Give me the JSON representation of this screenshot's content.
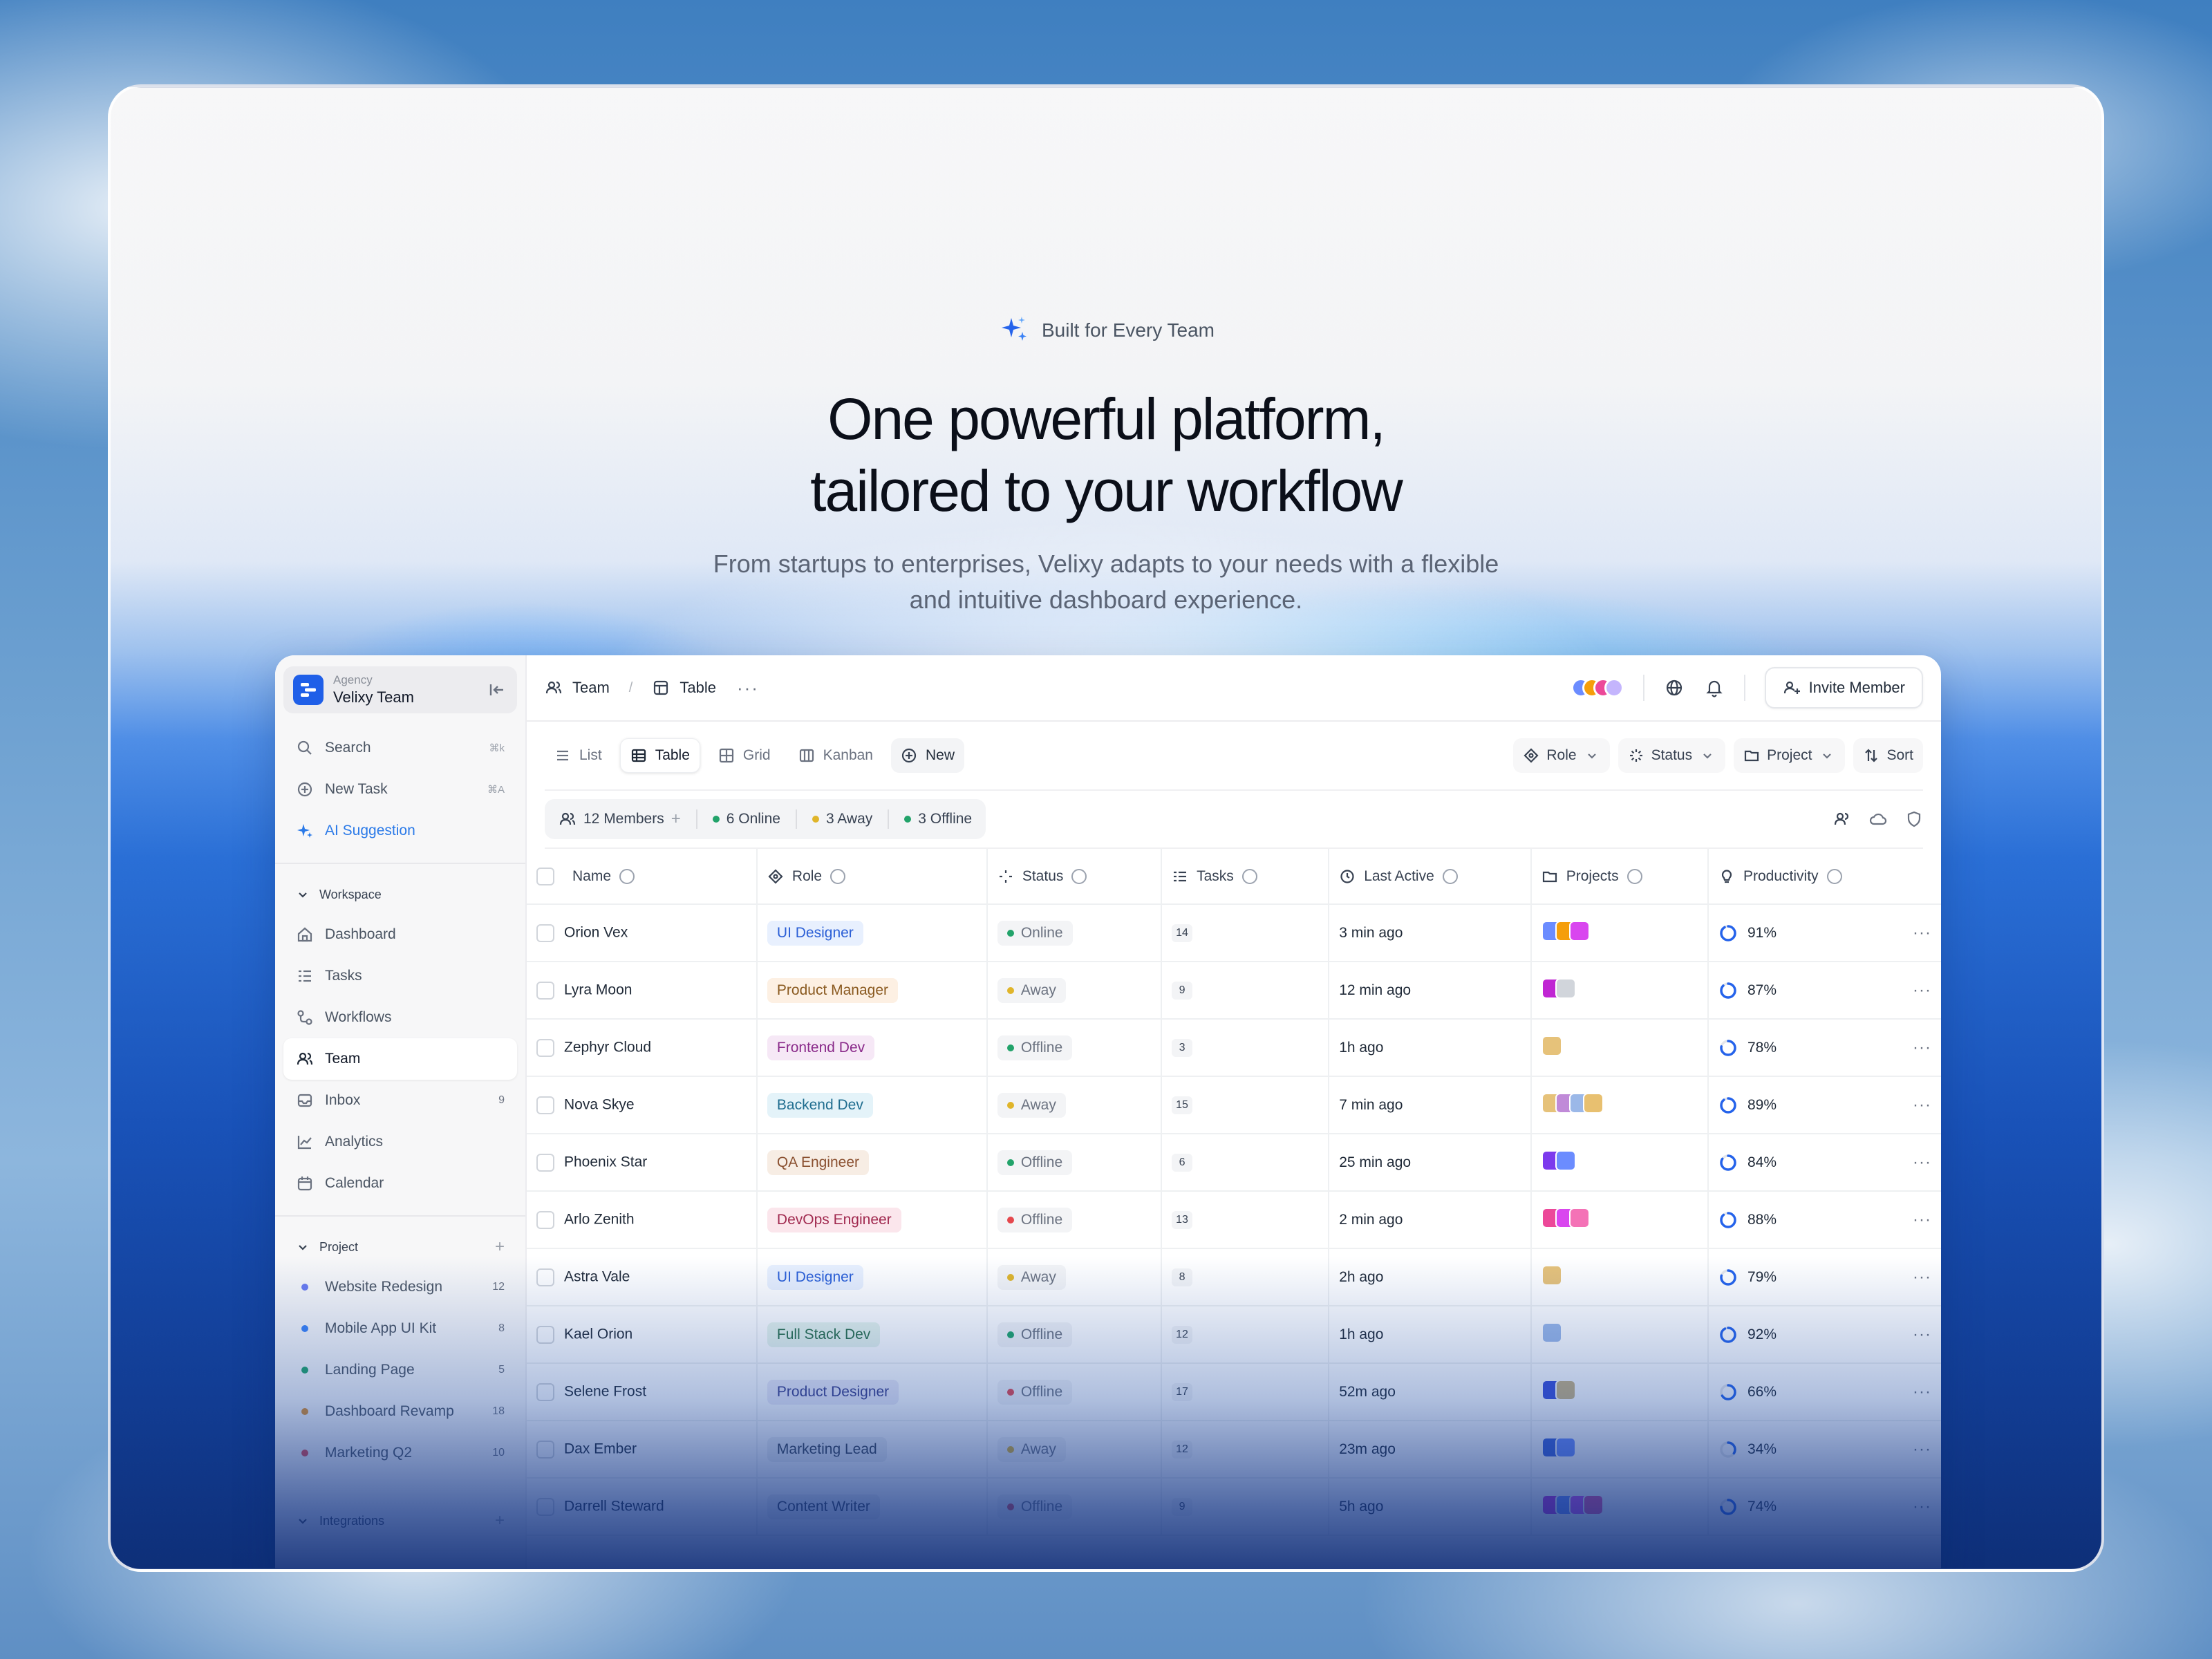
{
  "hero": {
    "badge": "Built for Every Team",
    "headline_1": "One powerful platform,",
    "headline_2": "tailored to your workflow",
    "sub_1": "From startups to enterprises, Velixy adapts to your needs with a flexible",
    "sub_2": "and intuitive dashboard experience."
  },
  "workspace": {
    "type": "Agency",
    "name": "Velixy Team"
  },
  "sidebar": {
    "quick": [
      {
        "label": "Search",
        "kbd": "⌘k",
        "icon": "search-icon"
      },
      {
        "label": "New Task",
        "kbd": "⌘A",
        "icon": "plus-circle-icon"
      },
      {
        "label": "AI Suggestion",
        "kbd": "",
        "icon": "sparkle-icon"
      }
    ],
    "workspace_title": "Workspace",
    "workspace_items": [
      {
        "label": "Dashboard",
        "icon": "home-icon",
        "count": ""
      },
      {
        "label": "Tasks",
        "icon": "tasks-icon",
        "count": ""
      },
      {
        "label": "Workflows",
        "icon": "workflow-icon",
        "count": ""
      },
      {
        "label": "Team",
        "icon": "team-icon",
        "count": ""
      },
      {
        "label": "Inbox",
        "icon": "inbox-icon",
        "count": "9"
      },
      {
        "label": "Analytics",
        "icon": "analytics-icon",
        "count": ""
      },
      {
        "label": "Calendar",
        "icon": "calendar-icon",
        "count": ""
      }
    ],
    "project_title": "Project",
    "projects": [
      {
        "label": "Website Redesign",
        "count": "12",
        "color": "#6b7cf0"
      },
      {
        "label": "Mobile App UI Kit",
        "count": "8",
        "color": "#3b82f6"
      },
      {
        "label": "Landing Page",
        "count": "5",
        "color": "#22a36a"
      },
      {
        "label": "Dashboard Revamp",
        "count": "18",
        "color": "#e0902a"
      },
      {
        "label": "Marketing Q2",
        "count": "10",
        "color": "#e5484d"
      }
    ],
    "integrations_title": "Integrations"
  },
  "topbar": {
    "crumb_1": "Team",
    "crumb_2": "Table",
    "invite": "Invite Member",
    "avatar_colors": [
      "#6b8cff",
      "#f59e0b",
      "#ec4899",
      "#c4b5fd"
    ]
  },
  "views": {
    "list": "List",
    "table": "Table",
    "grid": "Grid",
    "kanban": "Kanban",
    "new": "New",
    "role": "Role",
    "status": "Status",
    "project": "Project",
    "sort": "Sort"
  },
  "stats": {
    "members": "12 Members",
    "online": "6 Online",
    "away": "3 Away",
    "offline": "3 Offline"
  },
  "columns": {
    "name": "Name",
    "role": "Role",
    "status": "Status",
    "tasks": "Tasks",
    "last_active": "Last Active",
    "projects": "Projects",
    "productivity": "Productivity"
  },
  "rows": [
    {
      "name": "Orion Vex",
      "role": "UI Designer",
      "role_bg": "#e8f0fe",
      "role_fg": "#2b5fd6",
      "status": "Online",
      "status_color": "#22a36a",
      "tasks": "14",
      "last": "3 min ago",
      "projects": [
        "#6b8cff",
        "#f59e0b",
        "#d946ef"
      ],
      "prod": "91%",
      "prod_value": 0.91
    },
    {
      "name": "Lyra Moon",
      "role": "Product Manager",
      "role_bg": "#fdf0e3",
      "role_fg": "#8a5a20",
      "status": "Away",
      "status_color": "#e0b52a",
      "tasks": "9",
      "last": "12 min ago",
      "projects": [
        "#c026d3",
        "#d1d5db"
      ],
      "prod": "87%",
      "prod_value": 0.87
    },
    {
      "name": "Zephyr Cloud",
      "role": "Frontend Dev",
      "role_bg": "#f6e8f6",
      "role_fg": "#8a2a8a",
      "status": "Offline",
      "status_color": "#22a36a",
      "tasks": "3",
      "last": "1h ago",
      "projects": [
        "#e6c27a"
      ],
      "prod": "78%",
      "prod_value": 0.78
    },
    {
      "name": "Nova Skye",
      "role": "Backend Dev",
      "role_bg": "#e4f3f9",
      "role_fg": "#1f6d8f",
      "status": "Away",
      "status_color": "#e0b52a",
      "tasks": "15",
      "last": "7 min ago",
      "projects": [
        "#e6c27a",
        "#c08ad8",
        "#9bb8e8",
        "#e8c070"
      ],
      "prod": "89%",
      "prod_value": 0.89
    },
    {
      "name": "Phoenix Star",
      "role": "QA Engineer",
      "role_bg": "#f7ede4",
      "role_fg": "#8a5030",
      "status": "Offline",
      "status_color": "#22a36a",
      "tasks": "6",
      "last": "25 min ago",
      "projects": [
        "#7c3aed",
        "#6b8cff"
      ],
      "prod": "84%",
      "prod_value": 0.84
    },
    {
      "name": "Arlo Zenith",
      "role": "DevOps Engineer",
      "role_bg": "#fbe6ec",
      "role_fg": "#a12a50",
      "status": "Offline",
      "status_color": "#e5484d",
      "tasks": "13",
      "last": "2 min ago",
      "projects": [
        "#ec4899",
        "#d946ef",
        "#f472b6"
      ],
      "prod": "88%",
      "prod_value": 0.88
    },
    {
      "name": "Astra Vale",
      "role": "UI Designer",
      "role_bg": "#e8f0fe",
      "role_fg": "#2b5fd6",
      "status": "Away",
      "status_color": "#e0b52a",
      "tasks": "8",
      "last": "2h ago",
      "projects": [
        "#e6c27a"
      ],
      "prod": "79%",
      "prod_value": 0.79
    },
    {
      "name": "Kael Orion",
      "role": "Full Stack Dev",
      "role_bg": "#e6f4ec",
      "role_fg": "#2a6f4a",
      "status": "Offline",
      "status_color": "#22a36a",
      "tasks": "12",
      "last": "1h ago",
      "projects": [
        "#9bb8e8"
      ],
      "prod": "92%",
      "prod_value": 0.92
    },
    {
      "name": "Selene Frost",
      "role": "Product Designer",
      "role_bg": "#ecebf7",
      "role_fg": "#3b3f8a",
      "status": "Offline",
      "status_color": "#e5484d",
      "tasks": "17",
      "last": "52m ago",
      "projects": [
        "#3b4fd8",
        "#c9b380"
      ],
      "prod": "66%",
      "prod_value": 0.66
    },
    {
      "name": "Dax Ember",
      "role": "Marketing Lead",
      "role_bg": "#eef0f3",
      "role_fg": "#374151",
      "status": "Away",
      "status_color": "#e0b52a",
      "tasks": "12",
      "last": "23m ago",
      "projects": [
        "#3b5fd8",
        "#6b8cff"
      ],
      "prod": "34%",
      "prod_value": 0.34
    },
    {
      "name": "Darrell Steward",
      "role": "Content Writer",
      "role_bg": "#eef0f3",
      "role_fg": "#374151",
      "status": "Offline",
      "status_color": "#e5484d",
      "tasks": "9",
      "last": "5h ago",
      "projects": [
        "#c026d3",
        "#6b8cff",
        "#d946ef",
        "#ec4899"
      ],
      "prod": "74%",
      "prod_value": 0.74
    }
  ]
}
